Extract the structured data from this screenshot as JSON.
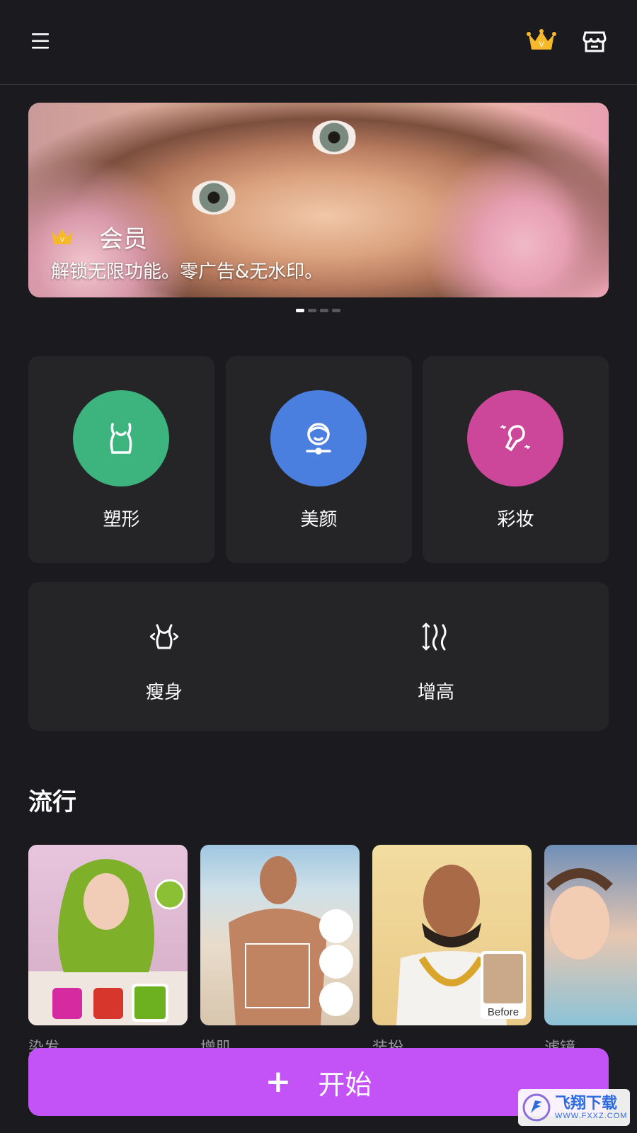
{
  "topbar": {
    "menu_icon": "hamburger-icon",
    "vip_icon": "crown-icon",
    "store_icon": "store-icon",
    "crown_color": "#f5b92a"
  },
  "banner": {
    "title": "会员",
    "subtitle": "解锁无限功能。零广告&无水印。",
    "page_count": 4,
    "active_page": 1
  },
  "tools": [
    {
      "label": "塑形",
      "icon": "body-shape-icon",
      "color": "#3db47d"
    },
    {
      "label": "美颜",
      "icon": "face-beauty-icon",
      "color": "#4a7fe0"
    },
    {
      "label": "彩妆",
      "icon": "makeup-brush-icon",
      "color": "#cc4799"
    }
  ],
  "extra_tools": [
    {
      "label": "瘦身",
      "icon": "slim-body-icon"
    },
    {
      "label": "增高",
      "icon": "height-increase-icon"
    }
  ],
  "trending": {
    "title": "流行",
    "cards": [
      {
        "label": "染发",
        "badge": ""
      },
      {
        "label": "增肌",
        "badge": ""
      },
      {
        "label": "装扮",
        "badge": "Before"
      },
      {
        "label": "滤镜",
        "badge": ""
      }
    ]
  },
  "start_button": {
    "label": "开始",
    "icon": "plus-icon",
    "color": "#c353f7"
  },
  "watermark": {
    "title": "飞翔下载",
    "url": "WWW.FXXZ.COM"
  }
}
